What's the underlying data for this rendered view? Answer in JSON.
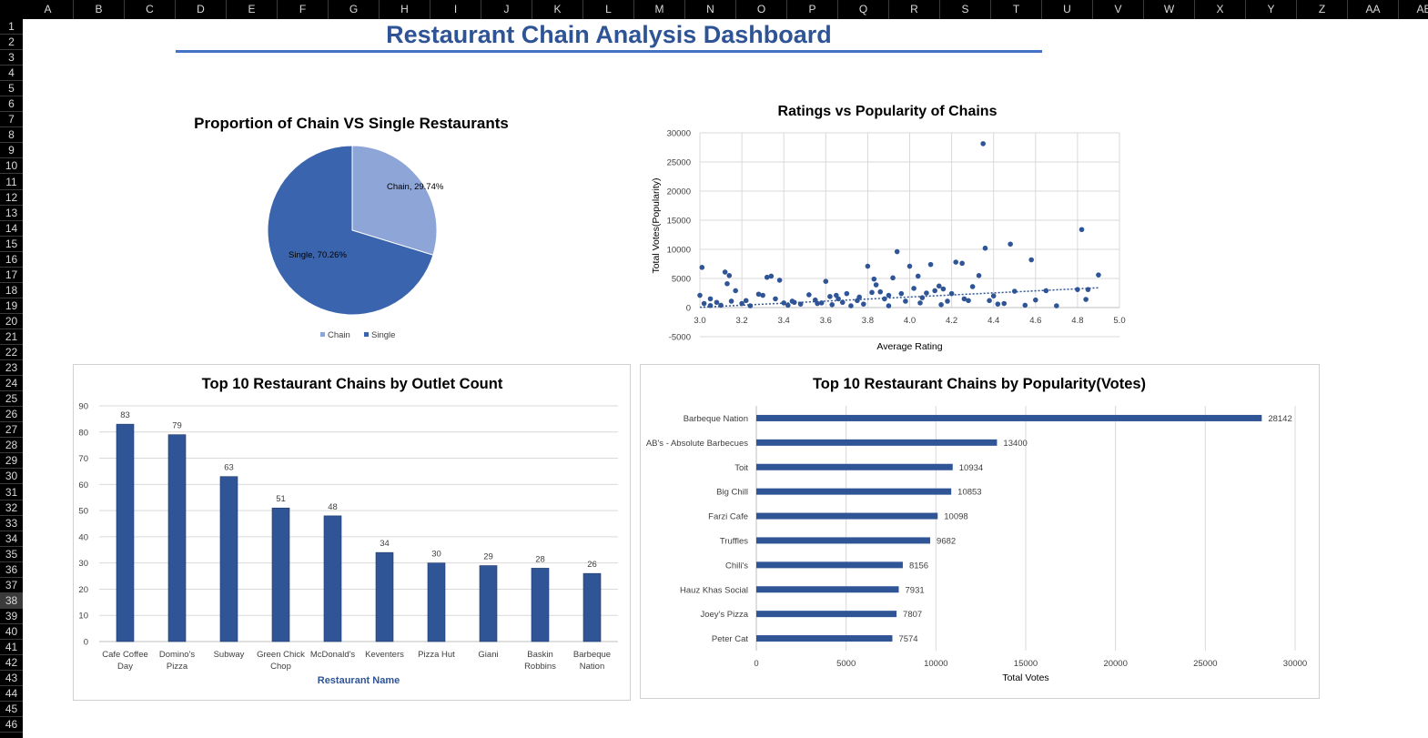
{
  "sheet": {
    "columns": [
      "A",
      "B",
      "C",
      "D",
      "E",
      "F",
      "G",
      "H",
      "I",
      "J",
      "K",
      "L",
      "M",
      "N",
      "O",
      "P",
      "Q",
      "R",
      "S",
      "T",
      "U",
      "V",
      "W",
      "X",
      "Y",
      "Z",
      "AA",
      "AB"
    ],
    "rows": [
      "1",
      "2",
      "3",
      "4",
      "5",
      "6",
      "7",
      "8",
      "9",
      "10",
      "11",
      "12",
      "13",
      "14",
      "15",
      "16",
      "17",
      "18",
      "19",
      "20",
      "21",
      "22",
      "23",
      "24",
      "25",
      "26",
      "27",
      "28",
      "29",
      "30",
      "31",
      "32",
      "33",
      "34",
      "35",
      "36",
      "37",
      "38",
      "39",
      "40",
      "41",
      "42",
      "43",
      "44",
      "45",
      "46"
    ],
    "selected_row": "38"
  },
  "dashboard": {
    "title": "Restaurant Chain Analysis Dashboard"
  },
  "colors": {
    "dark_blue": "#2f5597",
    "light_blue": "#8ea5d8",
    "mid_blue": "#3a64ad",
    "title_blue": "#2e5496"
  },
  "chart_data": [
    {
      "type": "pie",
      "title": "Proportion of Chain VS Single Restaurants",
      "categories": [
        "Chain",
        "Single"
      ],
      "values": [
        29.74,
        70.26
      ],
      "data_labels": [
        "Chain, 29.74%",
        "Single, 70.26%"
      ],
      "colors": [
        "#8ea5d8",
        "#3a64ad"
      ],
      "legend": "bottom"
    },
    {
      "type": "scatter",
      "title": "Ratings vs Popularity of Chains",
      "xlabel": "Average Rating",
      "ylabel": "Total Votes(Popularity)",
      "xlim": [
        3.0,
        5.0
      ],
      "ylim": [
        -5000,
        30000
      ],
      "xticks": [
        "3.0",
        "3.2",
        "3.4",
        "3.6",
        "3.8",
        "4.0",
        "4.2",
        "4.4",
        "4.6",
        "4.8",
        "5.0"
      ],
      "yticks": [
        "30000",
        "25000",
        "20000",
        "15000",
        "10000",
        "5000",
        "0",
        "-5000"
      ],
      "trendline": {
        "from": [
          3.0,
          50
        ],
        "to": [
          4.9,
          3400
        ]
      },
      "grid": true,
      "points": [
        [
          3.01,
          6900
        ],
        [
          3.0,
          2100
        ],
        [
          3.02,
          700
        ],
        [
          3.05,
          350
        ],
        [
          3.08,
          900
        ],
        [
          3.12,
          6100
        ],
        [
          3.14,
          5500
        ],
        [
          3.13,
          4100
        ],
        [
          3.17,
          2900
        ],
        [
          3.1,
          400
        ],
        [
          3.15,
          1100
        ],
        [
          3.2,
          700
        ],
        [
          3.24,
          300
        ],
        [
          3.28,
          2300
        ],
        [
          3.3,
          2100
        ],
        [
          3.32,
          5200
        ],
        [
          3.34,
          5400
        ],
        [
          3.36,
          1500
        ],
        [
          3.38,
          4700
        ],
        [
          3.4,
          800
        ],
        [
          3.42,
          400
        ],
        [
          3.45,
          900
        ],
        [
          3.48,
          600
        ],
        [
          3.52,
          2200
        ],
        [
          3.55,
          1300
        ],
        [
          3.58,
          800
        ],
        [
          3.6,
          4500
        ],
        [
          3.62,
          1900
        ],
        [
          3.65,
          2100
        ],
        [
          3.68,
          900
        ],
        [
          3.7,
          2400
        ],
        [
          3.72,
          300
        ],
        [
          3.75,
          1200
        ],
        [
          3.78,
          600
        ],
        [
          3.8,
          7100
        ],
        [
          3.82,
          2600
        ],
        [
          3.83,
          4900
        ],
        [
          3.84,
          3900
        ],
        [
          3.86,
          2700
        ],
        [
          3.88,
          1500
        ],
        [
          3.9,
          2100
        ],
        [
          3.92,
          5100
        ],
        [
          3.94,
          9600
        ],
        [
          3.96,
          2400
        ],
        [
          3.98,
          1100
        ],
        [
          4.0,
          7100
        ],
        [
          4.02,
          3300
        ],
        [
          4.04,
          5400
        ],
        [
          4.06,
          1700
        ],
        [
          4.08,
          2500
        ],
        [
          4.1,
          7400
        ],
        [
          4.12,
          2900
        ],
        [
          4.14,
          3700
        ],
        [
          4.16,
          3200
        ],
        [
          4.18,
          1100
        ],
        [
          4.2,
          2400
        ],
        [
          4.22,
          7800
        ],
        [
          4.25,
          7600
        ],
        [
          4.28,
          1200
        ],
        [
          4.3,
          3600
        ],
        [
          4.33,
          5500
        ],
        [
          4.35,
          28142
        ],
        [
          4.36,
          10200
        ],
        [
          4.38,
          1200
        ],
        [
          4.4,
          2000
        ],
        [
          4.45,
          700
        ],
        [
          4.48,
          10900
        ],
        [
          4.5,
          2800
        ],
        [
          4.55,
          400
        ],
        [
          4.58,
          8200
        ],
        [
          4.6,
          1300
        ],
        [
          4.65,
          2900
        ],
        [
          4.7,
          300
        ],
        [
          4.8,
          3100
        ],
        [
          4.82,
          13400
        ],
        [
          4.84,
          1400
        ],
        [
          4.85,
          3100
        ],
        [
          4.9,
          5600
        ],
        [
          3.05,
          1500
        ],
        [
          3.22,
          1200
        ],
        [
          3.44,
          1100
        ],
        [
          3.63,
          500
        ],
        [
          3.76,
          1800
        ],
        [
          3.9,
          300
        ],
        [
          4.05,
          800
        ],
        [
          4.15,
          500
        ],
        [
          4.26,
          1500
        ],
        [
          4.42,
          600
        ],
        [
          3.56,
          700
        ],
        [
          3.66,
          1500
        ]
      ]
    },
    {
      "type": "bar",
      "title": "Top 10 Restaurant Chains by Outlet Count",
      "xlabel": "Restaurant Name",
      "ylabel": "",
      "ylim": [
        0,
        90
      ],
      "yticks": [
        "0",
        "10",
        "20",
        "30",
        "40",
        "50",
        "60",
        "70",
        "80",
        "90"
      ],
      "categories": [
        [
          "Cafe Coffee",
          "Day"
        ],
        [
          "Domino's",
          "Pizza"
        ],
        [
          "Subway"
        ],
        [
          "Green Chick",
          "Chop"
        ],
        [
          "McDonald's"
        ],
        [
          "Keventers"
        ],
        [
          "Pizza Hut"
        ],
        [
          "Giani"
        ],
        [
          "Baskin",
          "Robbins"
        ],
        [
          "Barbeque",
          "Nation"
        ]
      ],
      "values": [
        83,
        79,
        63,
        51,
        48,
        34,
        30,
        29,
        28,
        26
      ],
      "color": "#2f5597"
    },
    {
      "type": "bar",
      "orientation": "horizontal",
      "title": "Top 10 Restaurant Chains by Popularity(Votes)",
      "xlabel": "Total Votes",
      "xlim": [
        0,
        30000
      ],
      "xticks": [
        "0",
        "5000",
        "10000",
        "15000",
        "20000",
        "25000",
        "30000"
      ],
      "categories": [
        "Barbeque Nation",
        "AB's - Absolute Barbecues",
        "Toit",
        "Big Chill",
        "Farzi Cafe",
        "Truffles",
        "Chili's",
        "Hauz Khas Social",
        "Joey's Pizza",
        "Peter Cat"
      ],
      "values": [
        28142,
        13400,
        10934,
        10853,
        10098,
        9682,
        8156,
        7931,
        7807,
        7574
      ],
      "color": "#2f5597"
    }
  ]
}
